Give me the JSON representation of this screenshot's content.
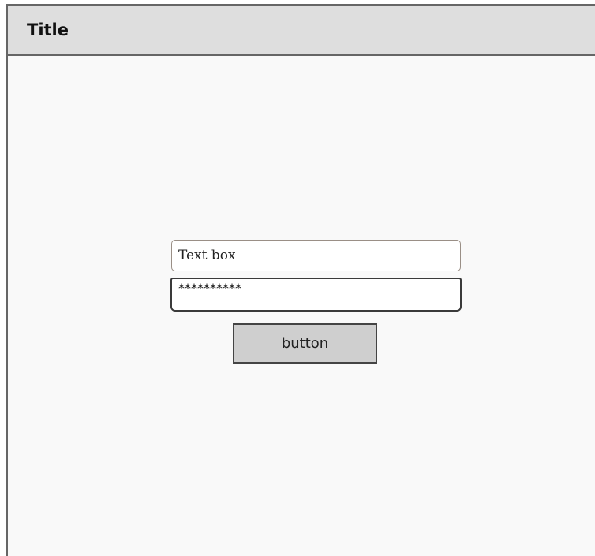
{
  "window": {
    "title": "Title"
  },
  "form": {
    "textbox_value": "Text box",
    "password_value": "**********",
    "button_label": "button"
  }
}
